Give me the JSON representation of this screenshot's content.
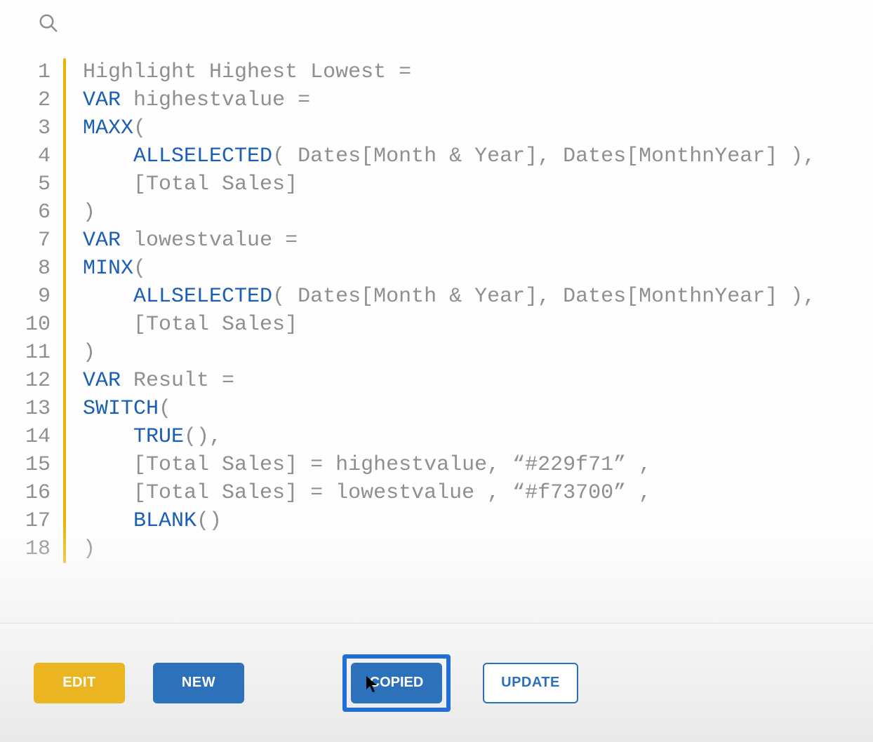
{
  "search": {
    "icon_name": "search-icon"
  },
  "code": {
    "line_numbers": [
      "1",
      "2",
      "3",
      "4",
      "5",
      "6",
      "7",
      "8",
      "9",
      "10",
      "11",
      "12",
      "13",
      "14",
      "15",
      "16",
      "17",
      "18"
    ],
    "lines": [
      {
        "segments": [
          {
            "cls": "id",
            "t": "Highlight Highest Lowest ="
          }
        ]
      },
      {
        "segments": [
          {
            "cls": "kw",
            "t": "VAR"
          },
          {
            "cls": "id",
            "t": " highestvalue ="
          }
        ]
      },
      {
        "segments": [
          {
            "cls": "fn",
            "t": "MAXX"
          },
          {
            "cls": "pn",
            "t": "("
          }
        ]
      },
      {
        "segments": [
          {
            "cls": "id",
            "t": "    "
          },
          {
            "cls": "fn",
            "t": "ALLSELECTED"
          },
          {
            "cls": "pn",
            "t": "("
          },
          {
            "cls": "id",
            "t": " Dates[Month & Year], Dates[MonthnYear] "
          },
          {
            "cls": "pn",
            "t": "),"
          }
        ]
      },
      {
        "segments": [
          {
            "cls": "id",
            "t": "    [Total Sales]"
          }
        ]
      },
      {
        "segments": [
          {
            "cls": "pn",
            "t": ")"
          }
        ]
      },
      {
        "segments": [
          {
            "cls": "kw",
            "t": "VAR"
          },
          {
            "cls": "id",
            "t": " lowestvalue ="
          }
        ]
      },
      {
        "segments": [
          {
            "cls": "fn",
            "t": "MINX"
          },
          {
            "cls": "pn",
            "t": "("
          }
        ]
      },
      {
        "segments": [
          {
            "cls": "id",
            "t": "    "
          },
          {
            "cls": "fn",
            "t": "ALLSELECTED"
          },
          {
            "cls": "pn",
            "t": "("
          },
          {
            "cls": "id",
            "t": " Dates[Month & Year], Dates[MonthnYear] "
          },
          {
            "cls": "pn",
            "t": "),"
          }
        ]
      },
      {
        "segments": [
          {
            "cls": "id",
            "t": "    [Total Sales]"
          }
        ]
      },
      {
        "segments": [
          {
            "cls": "pn",
            "t": ")"
          }
        ]
      },
      {
        "segments": [
          {
            "cls": "kw",
            "t": "VAR"
          },
          {
            "cls": "id",
            "t": " Result ="
          }
        ]
      },
      {
        "segments": [
          {
            "cls": "fn",
            "t": "SWITCH"
          },
          {
            "cls": "pn",
            "t": "("
          }
        ]
      },
      {
        "segments": [
          {
            "cls": "id",
            "t": "    "
          },
          {
            "cls": "fn",
            "t": "TRUE"
          },
          {
            "cls": "pn",
            "t": "(),"
          }
        ]
      },
      {
        "segments": [
          {
            "cls": "id",
            "t": "    [Total Sales] = highestvalue, “#229f71” ,"
          }
        ]
      },
      {
        "segments": [
          {
            "cls": "id",
            "t": "    [Total Sales] = lowestvalue , “#f73700” ,"
          }
        ]
      },
      {
        "segments": [
          {
            "cls": "id",
            "t": "    "
          },
          {
            "cls": "fn",
            "t": "BLANK"
          },
          {
            "cls": "pn",
            "t": "()"
          }
        ]
      },
      {
        "segments": [
          {
            "cls": "pn",
            "t": ")"
          }
        ]
      }
    ]
  },
  "buttons": {
    "edit": "EDIT",
    "new": "NEW",
    "copied": "COPIED",
    "update": "UPDATE"
  }
}
